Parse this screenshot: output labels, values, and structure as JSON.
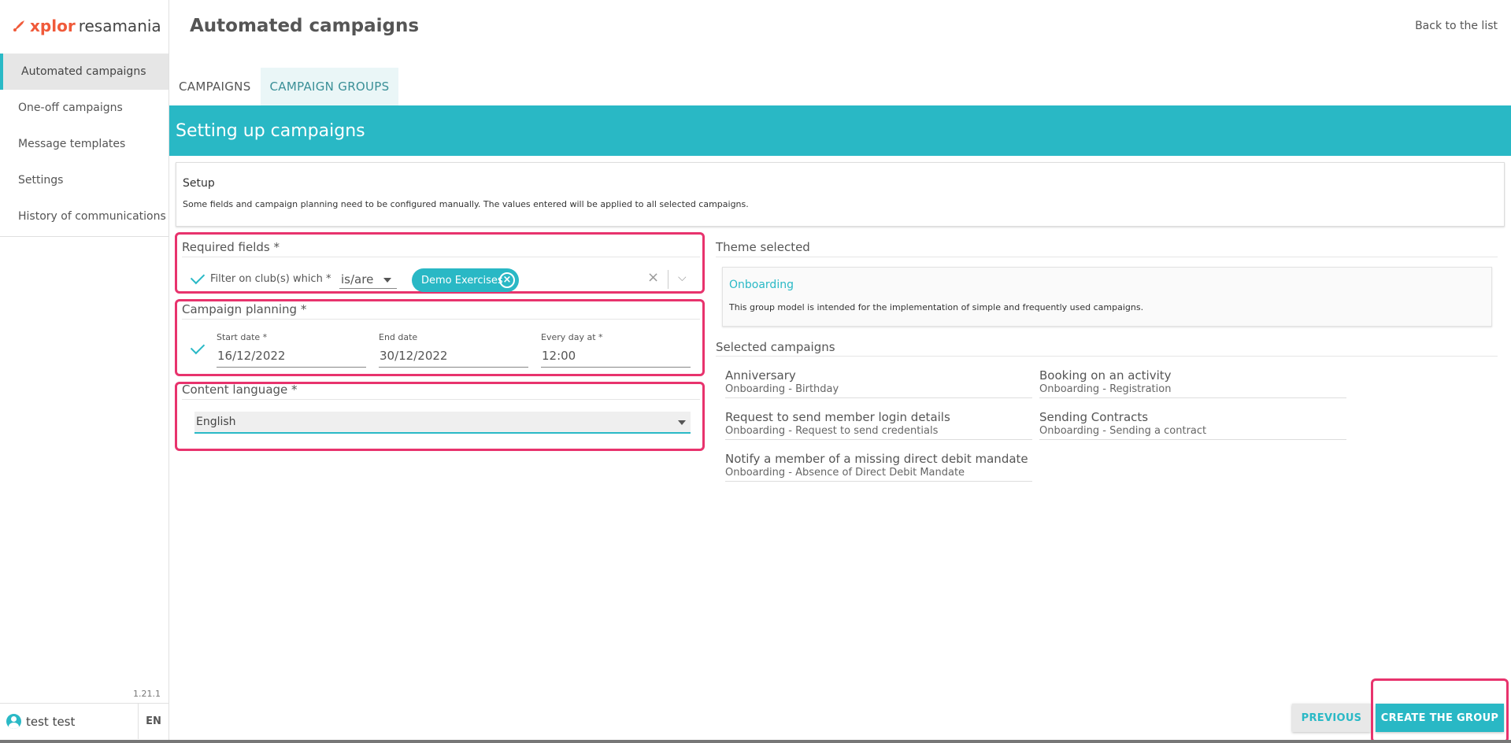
{
  "brand": {
    "word1": "xplor",
    "word2": "resamania",
    "accent": "#f05a3a"
  },
  "sidebar": {
    "items": [
      {
        "label": "Automated campaigns",
        "active": true
      },
      {
        "label": "One-off campaigns"
      },
      {
        "label": "Message templates"
      },
      {
        "label": "Settings"
      },
      {
        "label": "History of communications"
      }
    ],
    "version": "1.21.1",
    "user": "test test",
    "language": "EN"
  },
  "header": {
    "title": "Automated campaigns",
    "back_link": "Back to the list"
  },
  "tabs": [
    {
      "label": "CAMPAIGNS"
    },
    {
      "label": "CAMPAIGN GROUPS",
      "active": true
    }
  ],
  "banner": {
    "title": "Setting up campaigns"
  },
  "setup": {
    "title": "Setup",
    "description": "Some fields and campaign planning need to be configured manually. The values entered will be applied to all selected campaigns."
  },
  "required_fields": {
    "label": "Required fields *",
    "filter_label": "Filter on club(s) which *",
    "operator": "is/are",
    "chip": "Demo Exercises",
    "clear_icon": "close-icon",
    "dropdown_icon": "chevron-down-icon"
  },
  "planning": {
    "label": "Campaign planning *",
    "start_label": "Start date *",
    "start_value": "16/12/2022",
    "end_label": "End date",
    "end_value": "30/12/2022",
    "time_label": "Every day at  *",
    "time_value": "12:00"
  },
  "content_language": {
    "label": "Content language *",
    "value": "English"
  },
  "theme": {
    "label": "Theme selected",
    "name": "Onboarding",
    "description": "This group model is intended for the implementation of simple and frequently used campaigns."
  },
  "selected": {
    "label": "Selected campaigns",
    "items": [
      {
        "title": "Anniversary",
        "sub": "Onboarding - Birthday"
      },
      {
        "title": "Booking on an activity",
        "sub": "Onboarding - Registration"
      },
      {
        "title": "Request to send member login details",
        "sub": "Onboarding - Request to send credentials"
      },
      {
        "title": "Sending Contracts",
        "sub": "Onboarding - Sending a contract"
      },
      {
        "title": "Notify a member of a missing direct debit mandate",
        "sub": "Onboarding - Absence of Direct Debit Mandate"
      }
    ]
  },
  "buttons": {
    "previous": "PREVIOUS",
    "create": "CREATE THE GROUP"
  },
  "colors": {
    "accent": "#29b8c5",
    "highlight": "#e8336d"
  }
}
